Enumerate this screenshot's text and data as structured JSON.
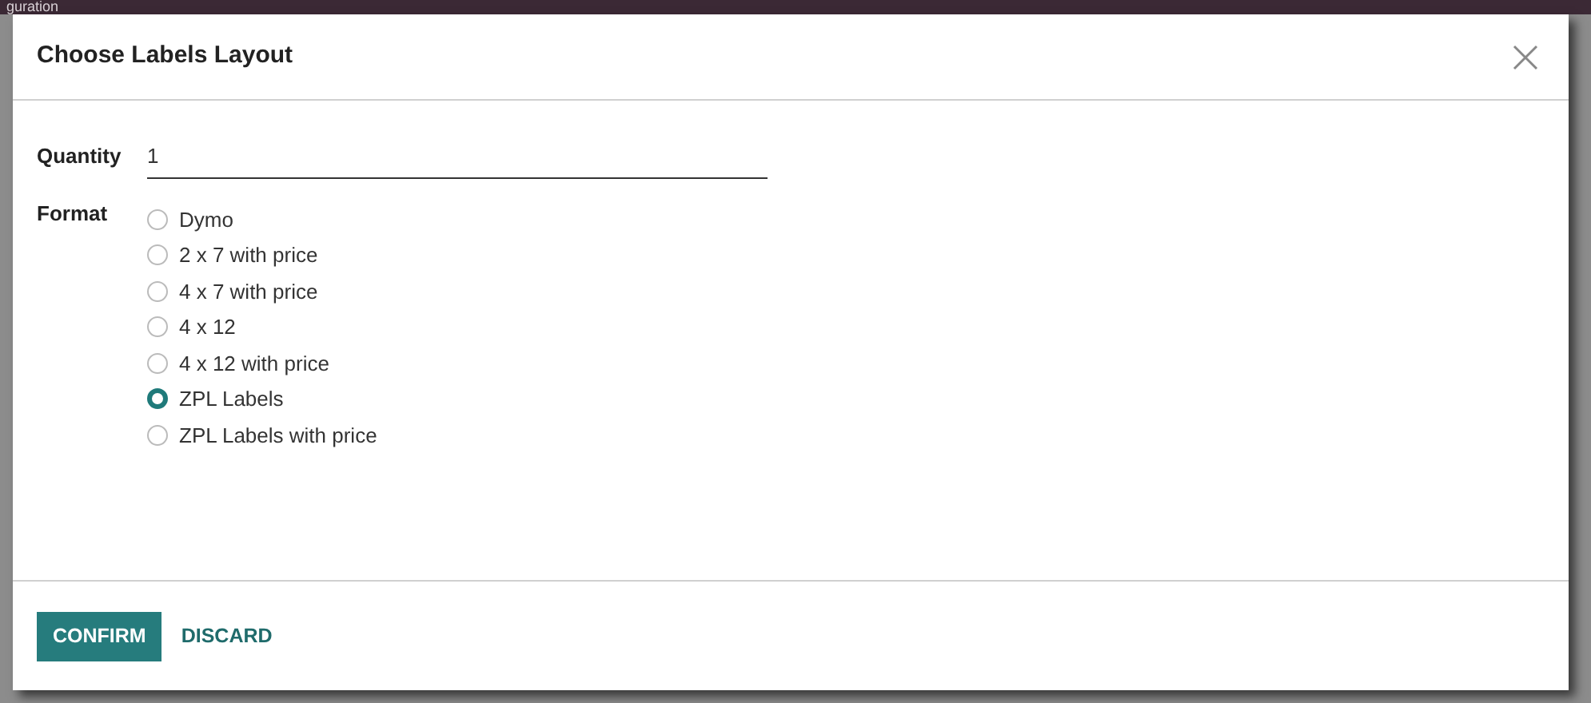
{
  "background": {
    "breadcrumb_fragment": "guration"
  },
  "dialog": {
    "title": "Choose Labels Layout",
    "quantity": {
      "label": "Quantity",
      "value": "1"
    },
    "format": {
      "label": "Format",
      "options": [
        {
          "label": "Dymo",
          "selected": false
        },
        {
          "label": "2 x 7 with price",
          "selected": false
        },
        {
          "label": "4 x 7 with price",
          "selected": false
        },
        {
          "label": "4 x 12",
          "selected": false
        },
        {
          "label": "4 x 12 with price",
          "selected": false
        },
        {
          "label": "ZPL Labels",
          "selected": true
        },
        {
          "label": "ZPL Labels with price",
          "selected": false
        }
      ]
    },
    "buttons": [
      {
        "label": "CONFIRM",
        "kind": "primary"
      },
      {
        "label": "DISCARD",
        "kind": "link"
      }
    ]
  }
}
